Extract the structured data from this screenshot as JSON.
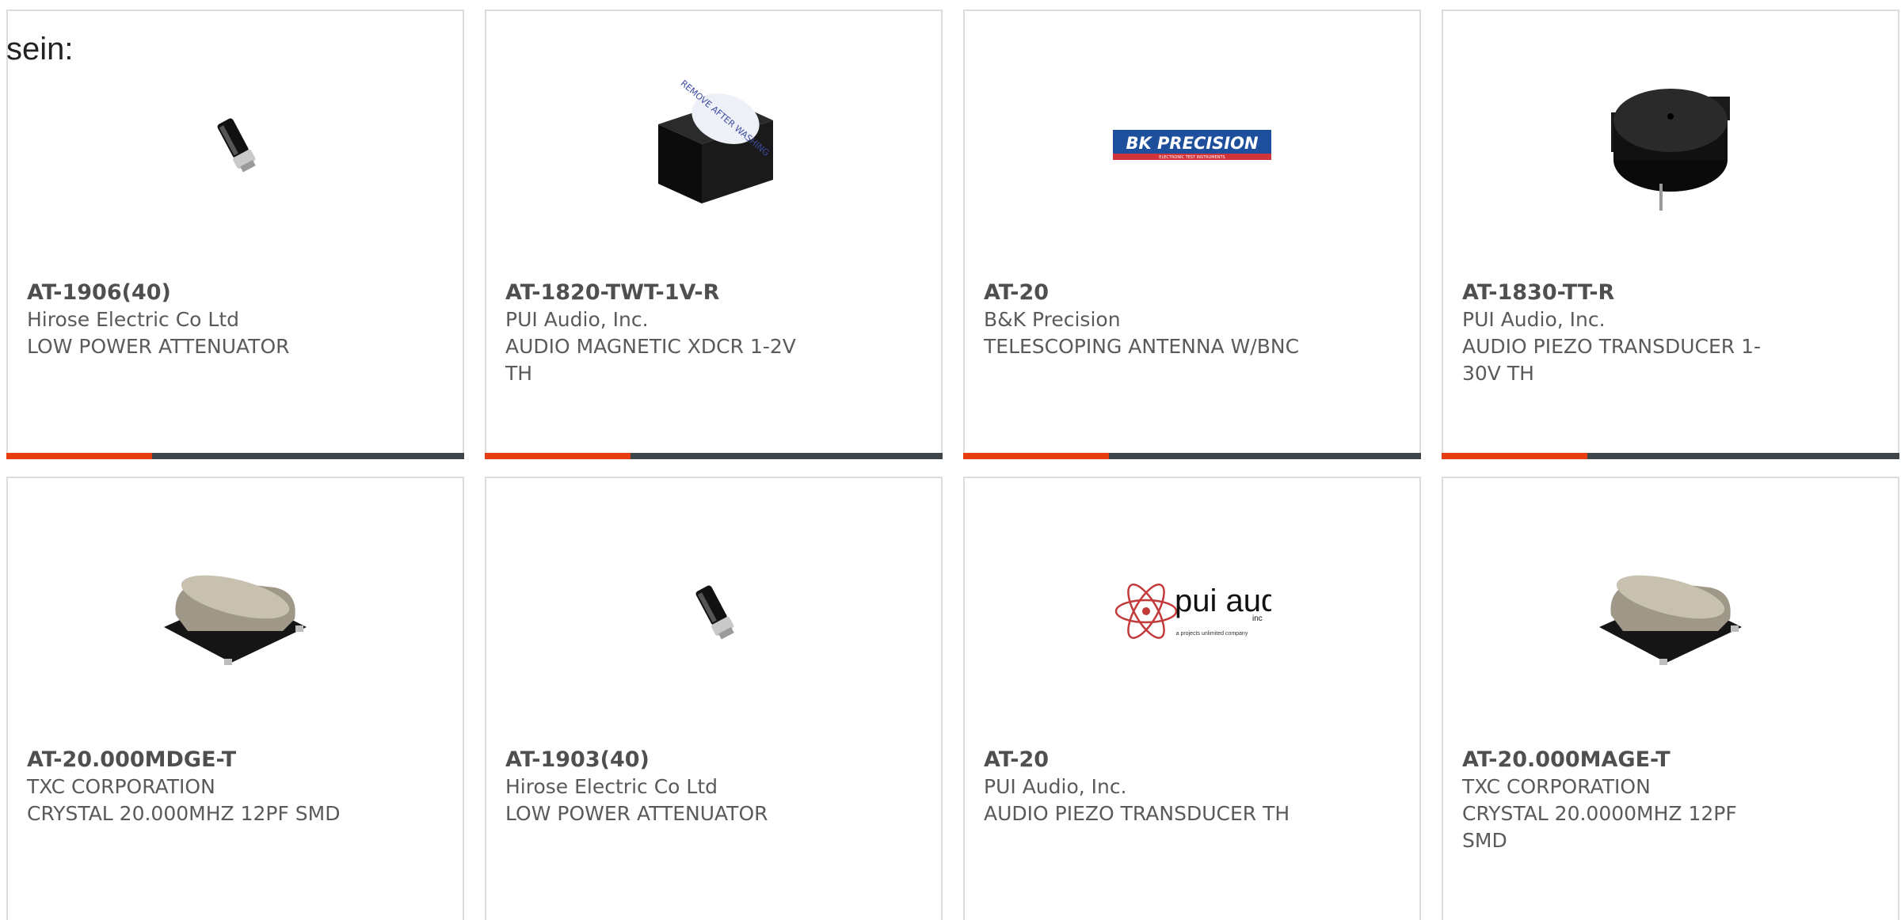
{
  "intro_text": "sein:",
  "colors": {
    "accent": "#e83c12",
    "bar": "#3f4448",
    "border": "#dcdcdc",
    "text": "#5a5a5a"
  },
  "products": [
    {
      "part": "AT-1906(40)",
      "manufacturer": "Hirose Electric Co Ltd",
      "description": "LOW POWER ATTENUATOR",
      "image": "black-cylinder-attenuator-icon"
    },
    {
      "part": "AT-1820-TWT-1V-R",
      "manufacturer": "PUI Audio, Inc.",
      "description": "AUDIO MAGNETIC XDCR 1-2V TH",
      "image": "black-cube-buzzer-with-label-icon",
      "image_label": "REMOVE AFTER WASHING"
    },
    {
      "part": "AT-20",
      "manufacturer": "B&K Precision",
      "description": "TELESCOPING ANTENNA W/BNC",
      "image": "bk-precision-logo",
      "logo_text": "BK PRECISION",
      "logo_subtext": "ELECTRONIC TEST INSTRUMENTS"
    },
    {
      "part": "AT-1830-TT-R",
      "manufacturer": "PUI Audio, Inc.",
      "description": "AUDIO PIEZO TRANSDUCER 1-30V TH",
      "image": "black-round-piezo-transducer-icon"
    },
    {
      "part": "AT-20.000MDGE-T",
      "manufacturer": "TXC CORPORATION",
      "description": "CRYSTAL 20.000MHZ 12PF SMD",
      "image": "metal-crystal-smd-icon"
    },
    {
      "part": "AT-1903(40)",
      "manufacturer": "Hirose Electric Co Ltd",
      "description": "LOW POWER ATTENUATOR",
      "image": "black-cylinder-attenuator-icon"
    },
    {
      "part": "AT-20",
      "manufacturer": "PUI Audio, Inc.",
      "description": "AUDIO PIEZO TRANSDUCER TH",
      "image": "pui-audio-logo",
      "logo_text": "pui audio",
      "logo_inc": "inc",
      "logo_subtext": "a projects unlimited company"
    },
    {
      "part": "AT-20.000MAGE-T",
      "manufacturer": "TXC CORPORATION",
      "description": "CRYSTAL 20.0000MHZ 12PF SMD",
      "image": "metal-crystal-smd-icon"
    }
  ]
}
